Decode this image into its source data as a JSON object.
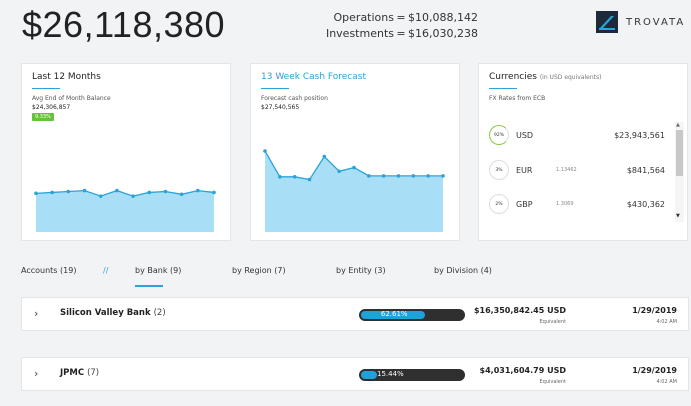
{
  "header": {
    "balance": "$26,118,380",
    "operations_label": "Operations",
    "operations_value": "$10,088,142",
    "investments_label": "Investments",
    "investments_value": "$16,030,238",
    "brand": "TROVATA"
  },
  "cards": {
    "last12": {
      "title": "Last 12 Months",
      "subtitle": "Avg End of Month Balance",
      "value": "$24,306,857",
      "badge": "9.33%"
    },
    "forecast": {
      "title": "13 Week Cash Forecast",
      "subtitle": "Forecast cash position",
      "value": "$27,540,565"
    },
    "currencies": {
      "title": "Currencies",
      "title_note": "(in USD equivalents)",
      "subtitle": "FX Rates from ECB",
      "rows": [
        {
          "pct": "92%",
          "code": "USD",
          "rate": "",
          "amount": "$23,943,561"
        },
        {
          "pct": "3%",
          "code": "EUR",
          "rate": "1.13462",
          "amount": "$841,564"
        },
        {
          "pct": "2%",
          "code": "GBP",
          "rate": "1.3069",
          "amount": "$430,362"
        }
      ]
    }
  },
  "chart_data": [
    {
      "type": "area",
      "values": [
        4.2,
        4.3,
        4.4,
        4.5,
        3.9,
        4.5,
        3.9,
        4.3,
        4.4,
        4.1,
        4.5,
        4.3
      ],
      "ylim": [
        0,
        10
      ],
      "color": "#a8dff7"
    },
    {
      "type": "area",
      "values": [
        8.8,
        6.0,
        6.0,
        5.7,
        8.2,
        6.6,
        7.0,
        6.1,
        6.1,
        6.1,
        6.1,
        6.1,
        6.1
      ],
      "ylim": [
        0,
        10
      ],
      "color": "#a8dff7"
    }
  ],
  "tabs": {
    "accounts": "Accounts (19)",
    "separator": "//",
    "by_bank": "by Bank (9)",
    "by_region": "by Region (7)",
    "by_entity": "by Entity (3)",
    "by_division": "by Division (4)"
  },
  "banks": [
    {
      "name": "Silicon Valley Bank",
      "count": "(2)",
      "pct": "62.61%",
      "pct_value": 62.61,
      "amount": "$16,350,842.45",
      "currency": "USD",
      "equiv": "Equivalent",
      "date": "1/29/2019",
      "time": "4:02 AM"
    },
    {
      "name": "JPMC",
      "count": "(7)",
      "pct": "15.44%",
      "pct_value": 15.44,
      "amount": "$4,031,604.79",
      "currency": "USD",
      "equiv": "Equivalent",
      "date": "1/29/2019",
      "time": "4:02 AM"
    }
  ],
  "colors": {
    "accent": "#2aa3d8",
    "badge_green": "#67c23a",
    "area_fill": "#a8dff7",
    "bar_dark": "#2f2f2f"
  }
}
